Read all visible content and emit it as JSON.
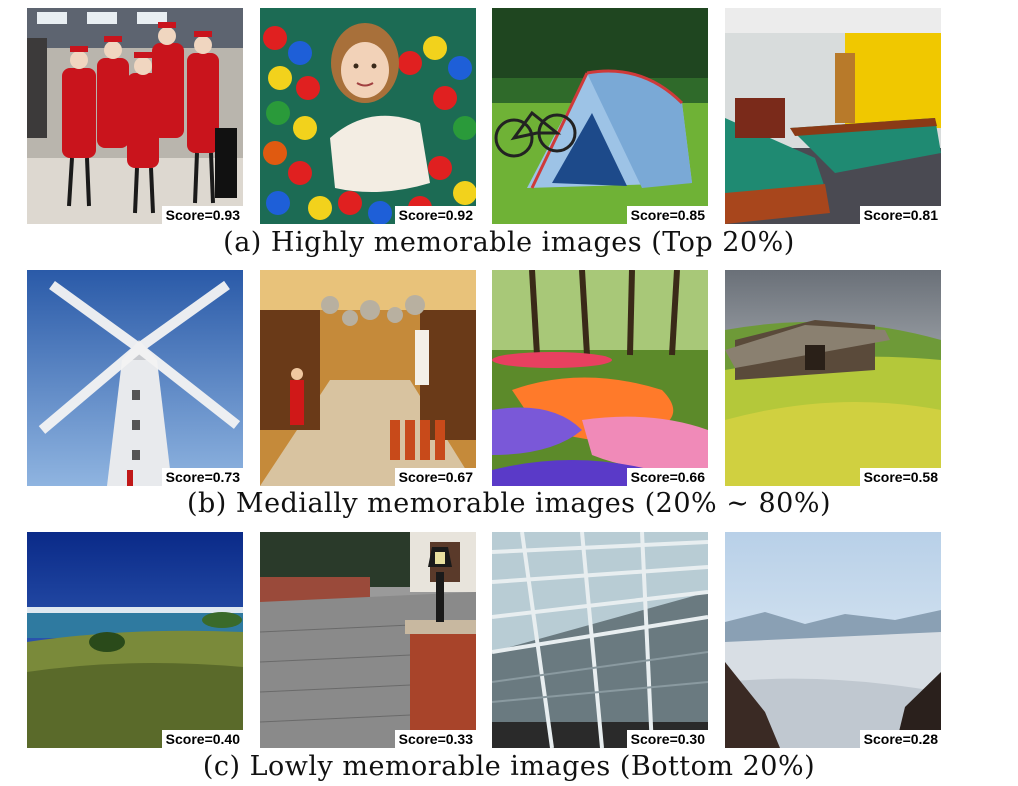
{
  "rows": [
    {
      "caption": "(a) Highly memorable images (Top 20%)",
      "images": [
        {
          "subject": "flight attendants walking in airport",
          "score": "Score=0.93"
        },
        {
          "subject": "child in ball pit",
          "score": "Score=0.92"
        },
        {
          "subject": "tent and bicycle on lawn",
          "score": "Score=0.85"
        },
        {
          "subject": "pool table room",
          "score": "Score=0.81"
        }
      ]
    },
    {
      "caption": "(b) Medially memorable images (20% ∼ 80%)",
      "images": [
        {
          "subject": "windmill against blue sky",
          "score": "Score=0.73"
        },
        {
          "subject": "kitchenware store interior",
          "score": "Score=0.67"
        },
        {
          "subject": "tulip garden in park",
          "score": "Score=0.66"
        },
        {
          "subject": "stone barn on grassy hill",
          "score": "Score=0.58"
        }
      ]
    },
    {
      "caption": "(c) Lowly memorable images (Bottom 20%)",
      "images": [
        {
          "subject": "grassy coast and sea",
          "score": "Score=0.40"
        },
        {
          "subject": "paved driveway with lamp post",
          "score": "Score=0.33"
        },
        {
          "subject": "glass roof structure",
          "score": "Score=0.30"
        },
        {
          "subject": "mountain glacier landscape",
          "score": "Score=0.28"
        }
      ]
    }
  ]
}
